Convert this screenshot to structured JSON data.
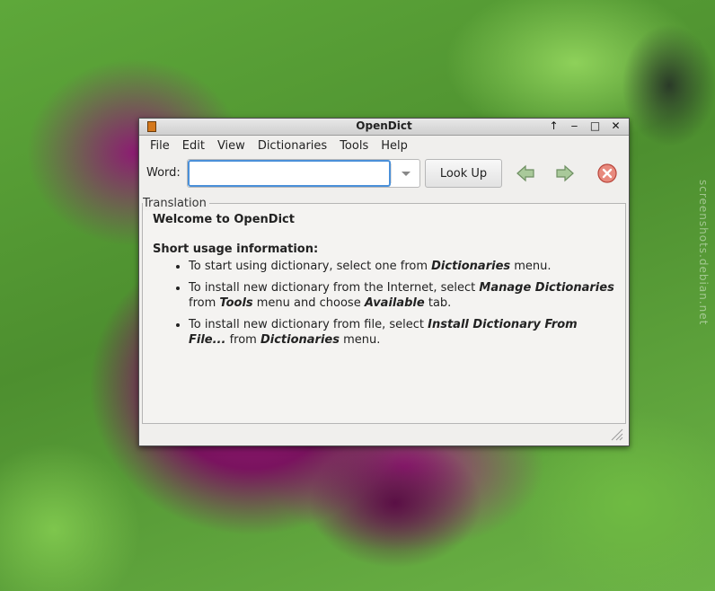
{
  "watermark": "screenshots.debian.net",
  "window": {
    "title": "OpenDict",
    "buttons": [
      "↑",
      "‒",
      "□",
      "✕"
    ]
  },
  "menubar": {
    "items": [
      "File",
      "Edit",
      "View",
      "Dictionaries",
      "Tools",
      "Help"
    ]
  },
  "toolbar": {
    "word_label": "Word:",
    "word_value": "",
    "lookup_label": "Look Up"
  },
  "translation": {
    "label": "Translation",
    "welcome": "Welcome to OpenDict",
    "usage_title": "Short usage information:",
    "items": [
      {
        "t1": "To start using dictionary, select one from ",
        "b1": "Dictionaries",
        "t2": " menu.",
        "b2": "",
        "t3": "",
        "b3": "",
        "t4": ""
      },
      {
        "t1": "To install new dictionary from the Internet, select ",
        "b1": "Manage Dictionaries",
        "t2": " from ",
        "b2": "Tools",
        "t3": " menu and choose ",
        "b3": "Available",
        "t4": " tab."
      },
      {
        "t1": "To install new dictionary from file, select ",
        "b1": "Install Dictionary From File...",
        "t2": " from ",
        "b2": "Dictionaries",
        "t3": " menu.",
        "b3": "",
        "t4": ""
      }
    ]
  },
  "colors": {
    "accent": "#4a90d9",
    "stop_red": "#e05a4a",
    "arrow_green": "#8ab37a"
  },
  "icons": {
    "app": "opendict-book-icon",
    "back": "arrow-left-icon",
    "forward": "arrow-right-icon",
    "stop": "stop-icon",
    "grip": "resize-grip-icon"
  }
}
